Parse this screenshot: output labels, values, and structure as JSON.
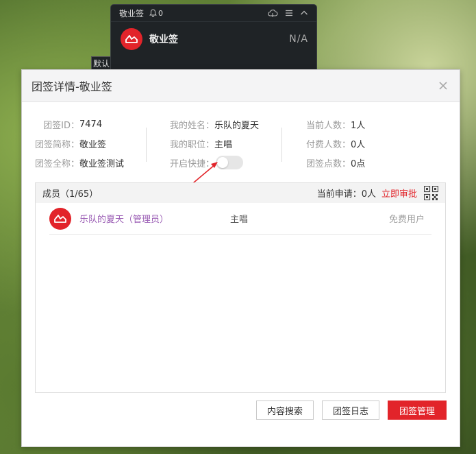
{
  "bg_widget": {
    "title": "敬业签",
    "bell_count": "0",
    "note_name": "敬业签",
    "note_status": "N/A",
    "side_label": "默认"
  },
  "dialog": {
    "title": "团签详情-敬业签",
    "info": {
      "col1": [
        {
          "key": "团签ID：",
          "value": "7474"
        },
        {
          "key": "团签简称：",
          "value": "敬业签"
        },
        {
          "key": "团签全称：",
          "value": "敬业签测试"
        }
      ],
      "col2": [
        {
          "key": "我的姓名：",
          "value": "乐队的夏天"
        },
        {
          "key": "我的职位：",
          "value": "主唱"
        },
        {
          "key": "开启快捷：",
          "value": ""
        }
      ],
      "col3": [
        {
          "key": "当前人数：",
          "value": "1人"
        },
        {
          "key": "付费人数：",
          "value": "0人"
        },
        {
          "key": "团签点数：",
          "value": "0点"
        }
      ]
    },
    "quick_toggle_on": false,
    "members": {
      "count_label": "成员（1/65）",
      "request_label": "当前申请：",
      "request_value": "0人",
      "approve_label": "立即审批",
      "rows": [
        {
          "name": "乐队的夏天（管理员）",
          "role": "主唱",
          "type": "免费用户"
        }
      ]
    },
    "buttons": {
      "search": "内容搜索",
      "log": "团签日志",
      "manage": "团签管理"
    }
  },
  "colors": {
    "accent": "#e2242a",
    "member_name": "#9b5eb5"
  }
}
